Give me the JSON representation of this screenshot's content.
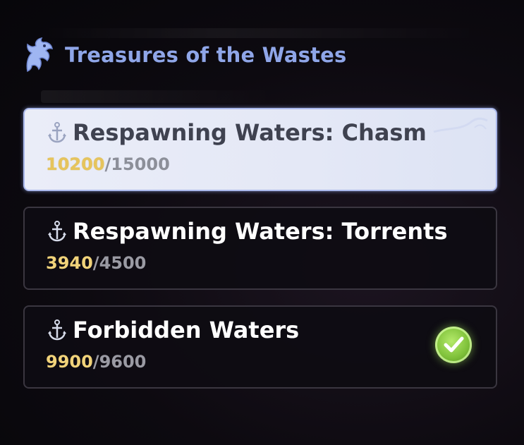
{
  "header": {
    "title": "Treasures of the Wastes",
    "icon": "horse-emblem-icon"
  },
  "items": [
    {
      "name": "Respawning Waters: Chasm",
      "current": "10200",
      "separator": "/",
      "max": "15000",
      "selected": true,
      "completed": false,
      "icon": "anchor-icon"
    },
    {
      "name": "Respawning Waters: Torrents",
      "current": "3940",
      "separator": "/",
      "max": "4500",
      "selected": false,
      "completed": false,
      "icon": "anchor-icon"
    },
    {
      "name": "Forbidden Waters",
      "current": "9900",
      "separator": "/",
      "max": "9600",
      "selected": false,
      "completed": true,
      "icon": "anchor-icon"
    }
  ],
  "colors": {
    "title": "#8fa6e8",
    "current_value": "#f1d37a",
    "max_value": "#9a9aa3",
    "check": "#7fc13a"
  }
}
